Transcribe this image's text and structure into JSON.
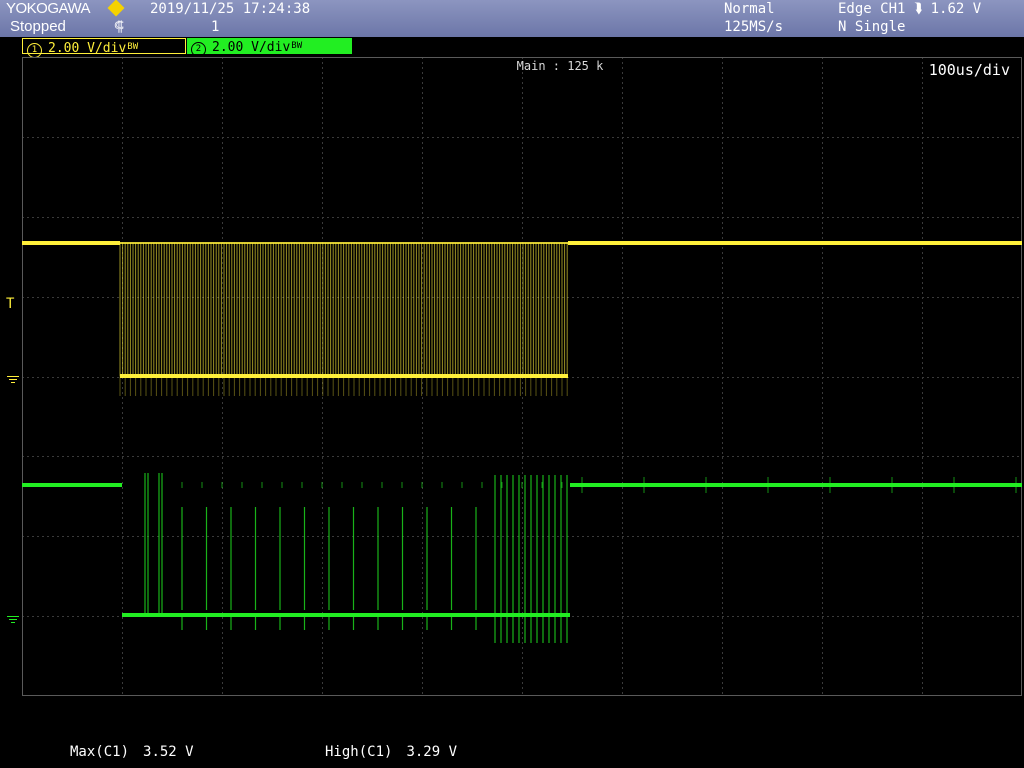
{
  "header": {
    "brand": "YOKOGAWA",
    "state": "Stopped",
    "state_glyph": "⸿",
    "datetime": "2019/11/25 17:24:38",
    "acq_count": "1",
    "trigger_mode": "Normal",
    "sample_rate": "125MS/s",
    "trigger_info": "Edge CH1 ⮯ 1.62 V",
    "trigger_type": "N Single"
  },
  "channels": [
    {
      "num": "1",
      "scale": "2.00 V",
      "unit_suffix": "/div",
      "bw_mark": "BW",
      "color": "#ffef3a"
    },
    {
      "num": "2",
      "scale": "2.00 V",
      "unit_suffix": "/div",
      "bw_mark": "BW",
      "color": "#22ee22"
    }
  ],
  "screen": {
    "main_label": "Main : 125 k",
    "timebase": "100us/div",
    "trigger_marker": "T",
    "grid_divisions": {
      "horizontal": 10,
      "vertical": 8
    },
    "grid_color": "#3a3a3a"
  },
  "measurements": [
    {
      "label": "Max(C1)",
      "value": "3.52 V"
    },
    {
      "label": "High(C1)",
      "value": "3.29 V"
    }
  ]
}
